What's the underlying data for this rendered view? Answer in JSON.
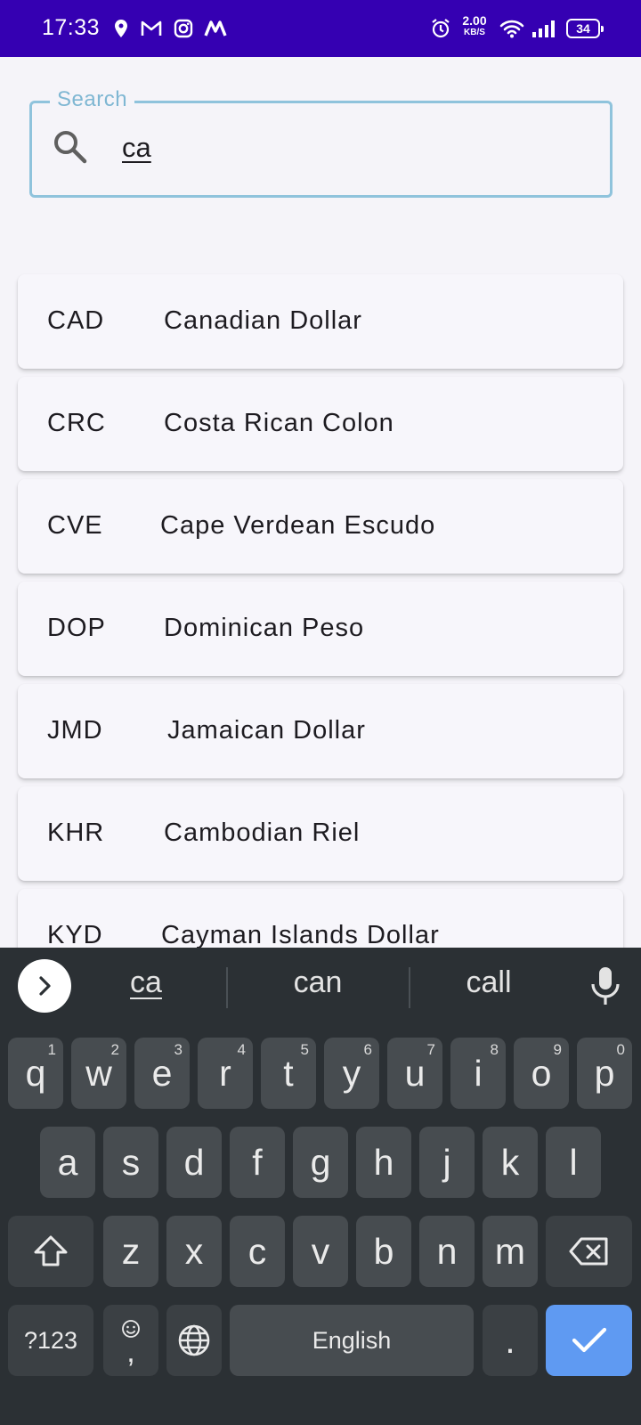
{
  "status_bar": {
    "time": "17:33",
    "icons": [
      "location-icon",
      "gmail-icon",
      "instagram-icon",
      "app-m-icon",
      "alarm-icon",
      "wifi-icon",
      "signal-icon",
      "battery-icon"
    ],
    "net_speed_value": "2.00",
    "net_speed_unit": "KB/S",
    "battery_level": "34"
  },
  "search": {
    "label": "Search",
    "value": "ca"
  },
  "currencies": [
    {
      "code": "CAD",
      "name": "Canadian Dollar"
    },
    {
      "code": "CRC",
      "name": "Costa Rican Colon"
    },
    {
      "code": "CVE",
      "name": "Cape Verdean Escudo"
    },
    {
      "code": "DOP",
      "name": "Dominican Peso"
    },
    {
      "code": "JMD",
      "name": "Jamaican Dollar"
    },
    {
      "code": "KHR",
      "name": "Cambodian Riel"
    },
    {
      "code": "KYD",
      "name": "Cayman Islands Dollar"
    }
  ],
  "keyboard": {
    "suggestions": [
      "ca",
      "can",
      "call"
    ],
    "row1": [
      "q",
      "w",
      "e",
      "r",
      "t",
      "y",
      "u",
      "i",
      "o",
      "p"
    ],
    "row1_hints": [
      "1",
      "2",
      "3",
      "4",
      "5",
      "6",
      "7",
      "8",
      "9",
      "0"
    ],
    "row2": [
      "a",
      "s",
      "d",
      "f",
      "g",
      "h",
      "j",
      "k",
      "l"
    ],
    "row3": [
      "z",
      "x",
      "c",
      "v",
      "b",
      "n",
      "m"
    ],
    "symbols_label": "?123",
    "comma_label": ",",
    "space_label": "English",
    "period_label": ".",
    "colors": {
      "background": "#2b3034",
      "key": "#474c50",
      "enter": "#5f9af2"
    }
  },
  "colors": {
    "status_bar": "#3500b2",
    "search_border": "#8fc3dc",
    "page_background": "#f5f4f9"
  }
}
